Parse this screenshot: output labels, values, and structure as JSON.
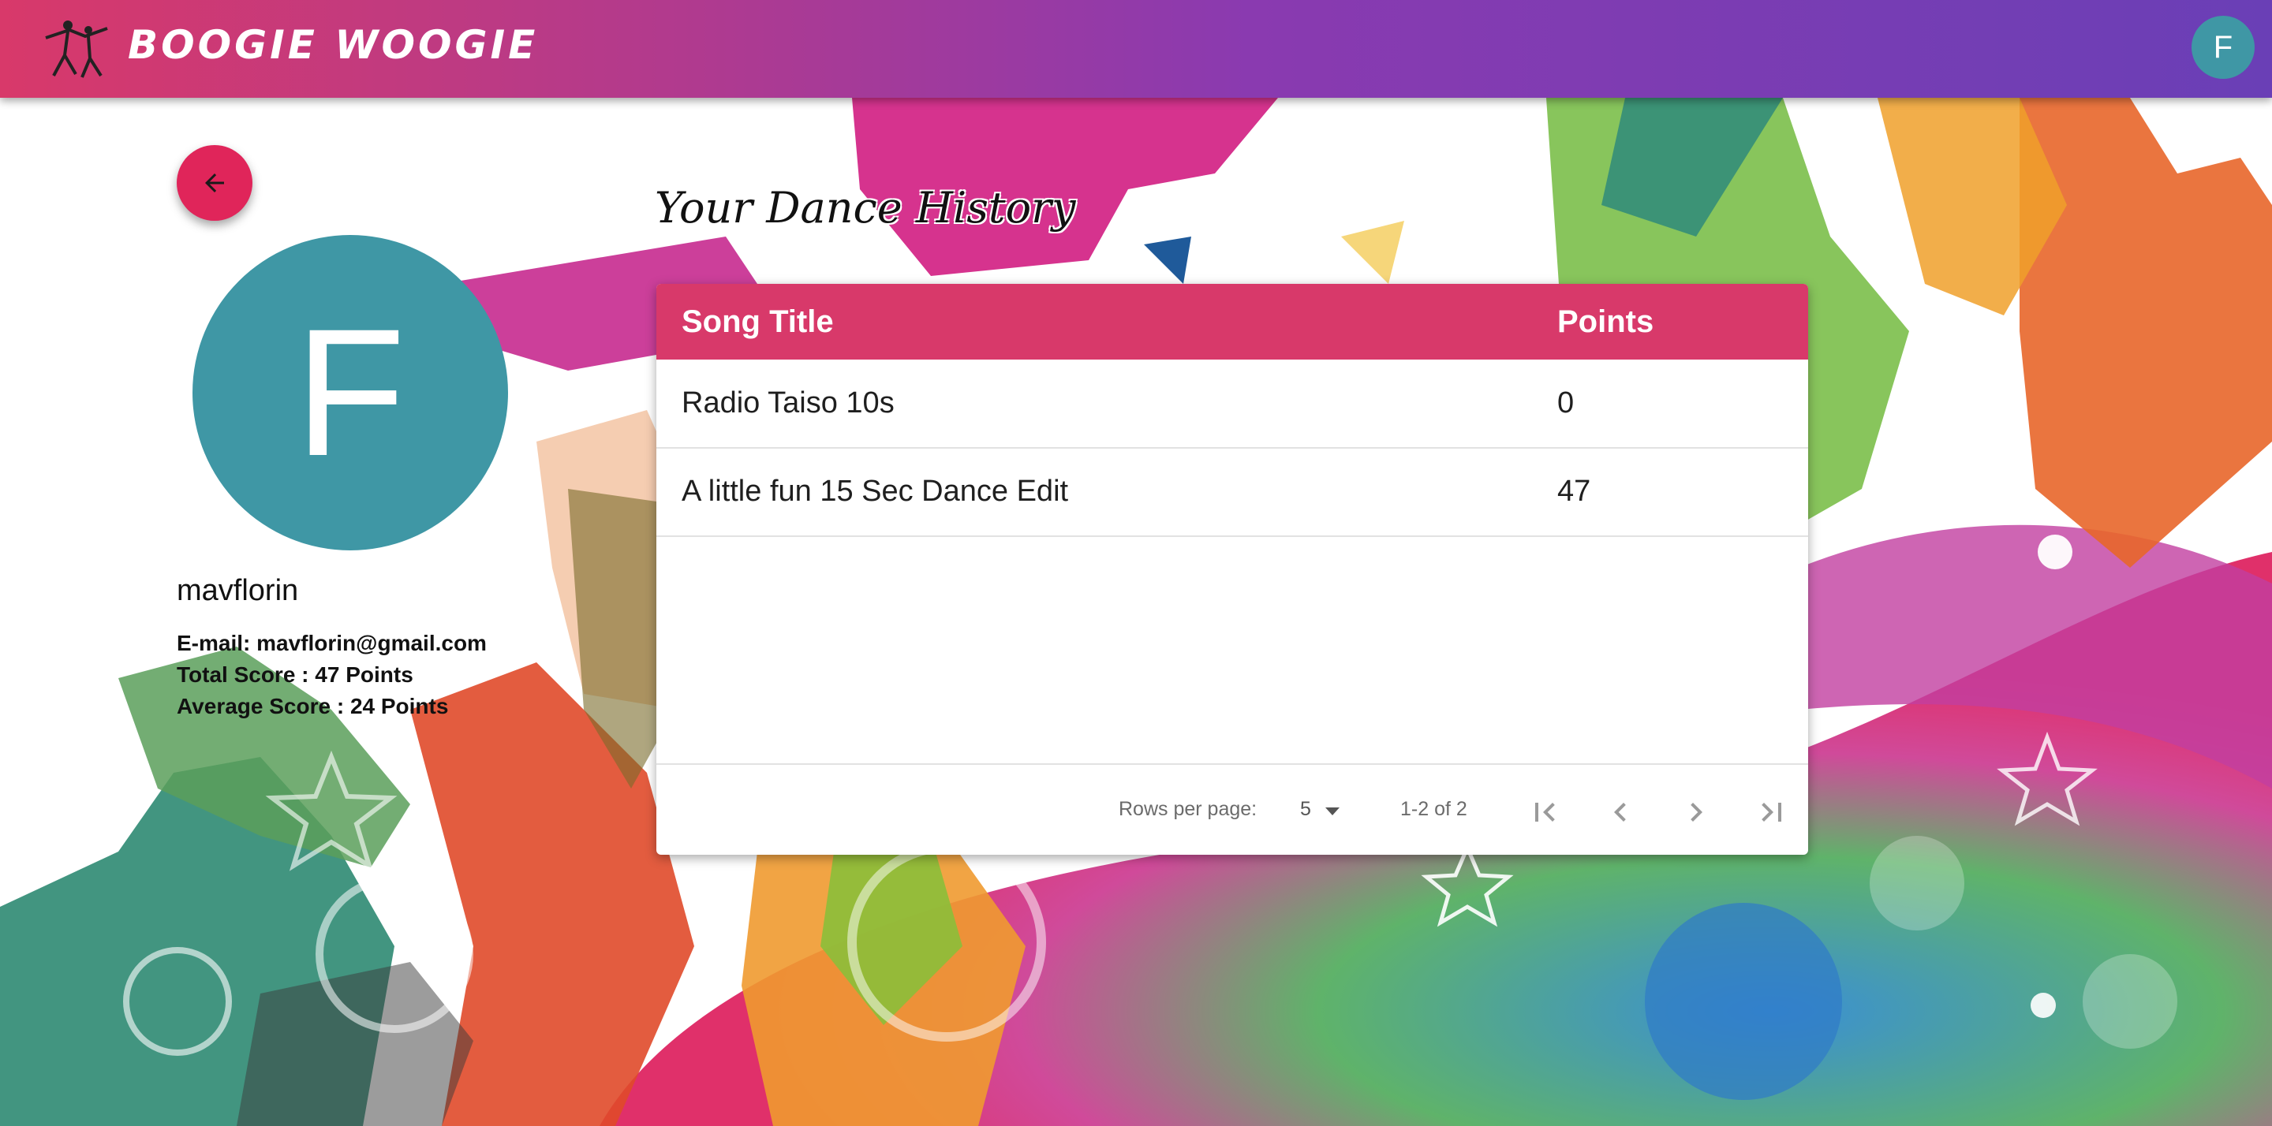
{
  "header": {
    "brand": "BOOGIE WOOGIE",
    "avatar_letter": "F"
  },
  "profile": {
    "avatar_letter": "F",
    "username": "mavflorin",
    "email_line": "E-mail: mavflorin@gmail.com",
    "total_line": "Total Score : 47 Points",
    "average_line": "Average Score : 24 Points"
  },
  "history": {
    "title": "Your Dance History",
    "columns": [
      "Song Title",
      "Points"
    ],
    "rows": [
      {
        "song": "Radio Taiso 10s",
        "points": "0"
      },
      {
        "song": "A little fun 15 Sec Dance Edit",
        "points": "47"
      }
    ]
  },
  "pagination": {
    "rows_per_page_label": "Rows per page:",
    "rows_per_page_value": "5",
    "range_text": "1-2 of 2"
  },
  "icons": {
    "logo": "dancing-couple-icon",
    "back": "arrow-left-icon",
    "dropdown": "caret-down-icon",
    "first": "first-page-icon",
    "prev": "chevron-left-icon",
    "next": "chevron-right-icon",
    "last": "last-page-icon"
  },
  "colors": {
    "header_start": "#d8396a",
    "header_end": "#6a3fb6",
    "table_header": "#d8396a",
    "avatar": "#3f97a5",
    "back_button": "#e0255a"
  }
}
